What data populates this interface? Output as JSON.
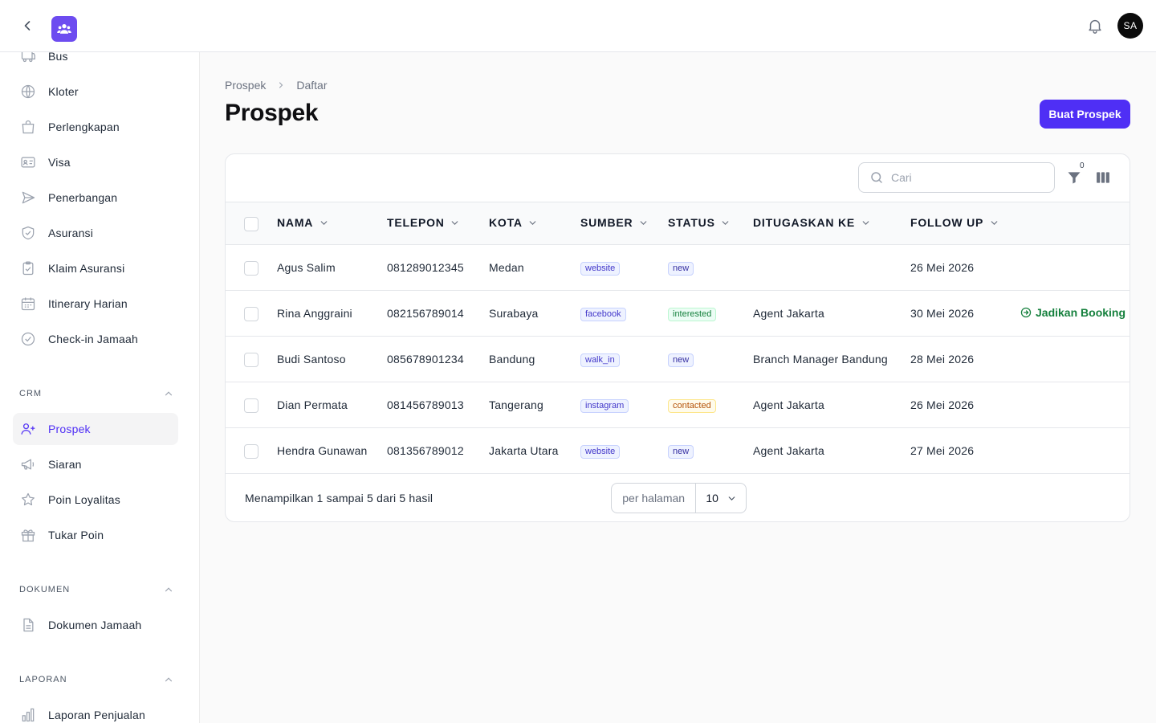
{
  "header": {
    "back_icon": "chevron-left-icon",
    "logo_icon": "users-group-icon",
    "bell_icon": "bell-icon",
    "avatar_initials": "SA"
  },
  "sidebar": {
    "items_top": [
      {
        "label": "Bus",
        "icon": "bus-icon"
      },
      {
        "label": "Kloter",
        "icon": "globe-icon"
      },
      {
        "label": "Perlengkapan",
        "icon": "shopping-bag-icon"
      },
      {
        "label": "Visa",
        "icon": "id-card-icon"
      },
      {
        "label": "Penerbangan",
        "icon": "paper-plane-icon"
      },
      {
        "label": "Asuransi",
        "icon": "shield-check-icon"
      },
      {
        "label": "Klaim Asuransi",
        "icon": "clipboard-check-icon"
      },
      {
        "label": "Itinerary Harian",
        "icon": "calendar-icon"
      },
      {
        "label": "Check-in Jamaah",
        "icon": "check-circle-icon"
      }
    ],
    "groups": [
      {
        "title": "CRM",
        "items": [
          {
            "label": "Prospek",
            "icon": "user-plus-icon",
            "active": true
          },
          {
            "label": "Siaran",
            "icon": "megaphone-icon"
          },
          {
            "label": "Poin Loyalitas",
            "icon": "star-icon"
          },
          {
            "label": "Tukar Poin",
            "icon": "gift-icon"
          }
        ]
      },
      {
        "title": "DOKUMEN",
        "items": [
          {
            "label": "Dokumen Jamaah",
            "icon": "document-text-icon"
          }
        ]
      },
      {
        "title": "LAPORAN",
        "items": [
          {
            "label": "Laporan Penjualan",
            "icon": "bar-chart-icon"
          }
        ]
      }
    ]
  },
  "breadcrumb": {
    "parent": "Prospek",
    "current": "Daftar"
  },
  "page": {
    "title": "Prospek",
    "create_button": "Buat Prospek"
  },
  "toolbar": {
    "search_placeholder": "Cari",
    "filter_count": "0",
    "filter_icon": "funnel-icon",
    "columns_icon": "view-columns-icon"
  },
  "table": {
    "columns": [
      "NAMA",
      "TELEPON",
      "KOTA",
      "SUMBER",
      "STATUS",
      "DITUGASKAN KE",
      "FOLLOW UP"
    ],
    "rows": [
      {
        "nama": "Agus Salim",
        "telepon": "081289012345",
        "kota": "Medan",
        "sumber": "website",
        "status": "new",
        "ditugaskan": "",
        "follow_up": "26 Mei 2026",
        "action": ""
      },
      {
        "nama": "Rina Anggraini",
        "telepon": "082156789014",
        "kota": "Surabaya",
        "sumber": "facebook",
        "status": "interested",
        "ditugaskan": "Agent Jakarta",
        "follow_up": "30 Mei 2026",
        "action": "Jadikan Booking"
      },
      {
        "nama": "Budi Santoso",
        "telepon": "085678901234",
        "kota": "Bandung",
        "sumber": "walk_in",
        "status": "new",
        "ditugaskan": "Branch Manager Bandung",
        "follow_up": "28 Mei 2026",
        "action": ""
      },
      {
        "nama": "Dian Permata",
        "telepon": "081456789013",
        "kota": "Tangerang",
        "sumber": "instagram",
        "status": "contacted",
        "ditugaskan": "Agent Jakarta",
        "follow_up": "26 Mei 2026",
        "action": ""
      },
      {
        "nama": "Hendra Gunawan",
        "telepon": "081356789012",
        "kota": "Jakarta Utara",
        "sumber": "website",
        "status": "new",
        "ditugaskan": "Agent Jakarta",
        "follow_up": "27 Mei 2026",
        "action": ""
      }
    ]
  },
  "pagination": {
    "summary": "Menampilkan 1 sampai 5 dari 5 hasil",
    "per_page_label": "per halaman",
    "per_page_value": "10"
  },
  "colors": {
    "primary": "#4f2ff5",
    "logo": "#6d4cf0",
    "success": "#15803d",
    "warning": "#b45309"
  }
}
